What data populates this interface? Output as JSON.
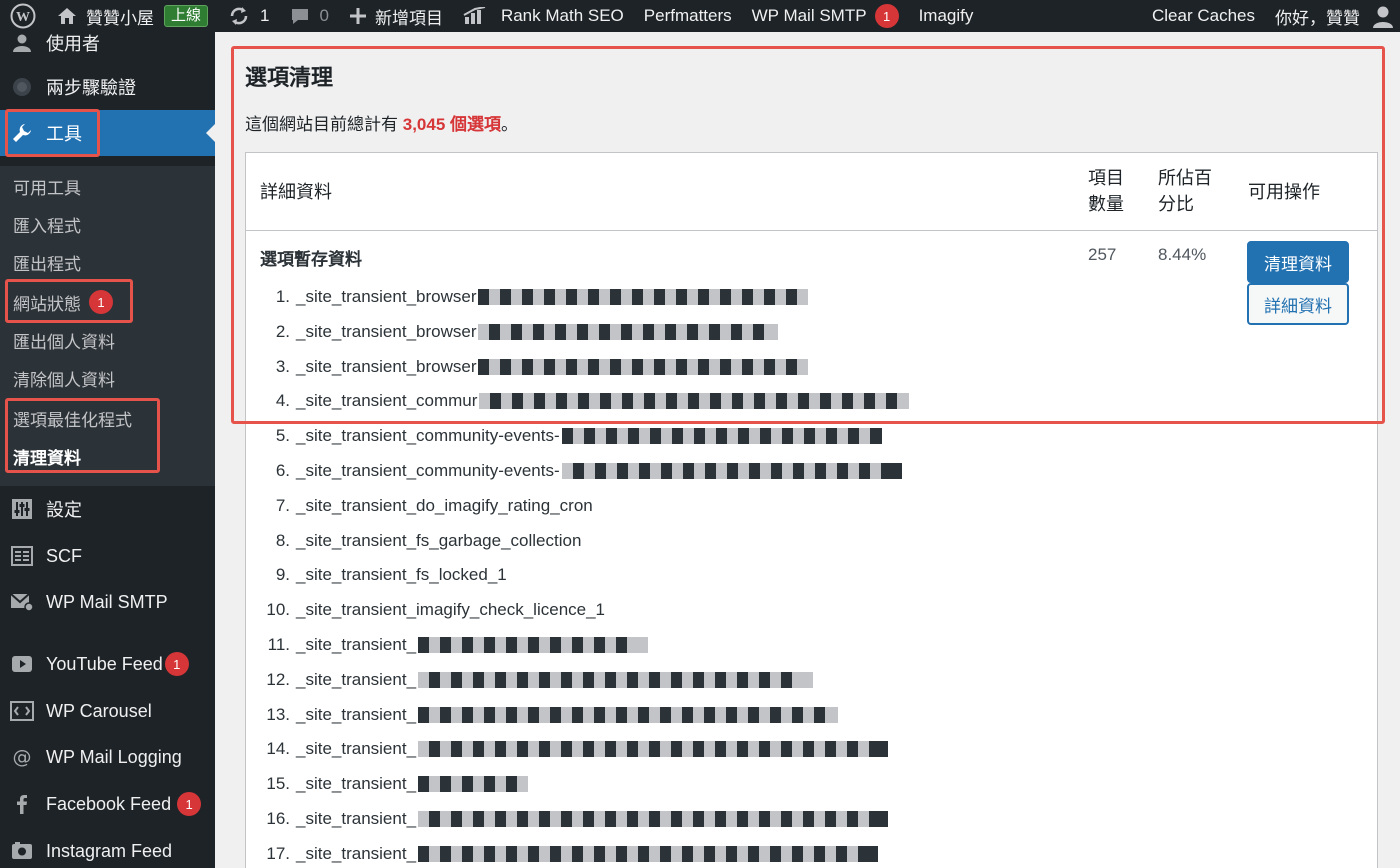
{
  "adminbar": {
    "site_name": "贊贊小屋",
    "live_label": "上線",
    "updates_count": "1",
    "comments_count": "0",
    "new_label": "新增項目",
    "rank_math": "Rank Math SEO",
    "perfmatters": "Perfmatters",
    "wp_mail_smtp": "WP Mail SMTP",
    "wp_mail_smtp_badge": "1",
    "imagify": "Imagify",
    "clear_caches": "Clear Caches",
    "greeting": "你好，贊贊"
  },
  "sidebar": {
    "users_partial": "使用者",
    "two_step": "兩步驟驗證",
    "tools": "工具",
    "submenu": [
      {
        "label": "可用工具"
      },
      {
        "label": "匯入程式"
      },
      {
        "label": "匯出程式"
      },
      {
        "label": "網站狀態",
        "badge": "1"
      },
      {
        "label": "匯出個人資料"
      },
      {
        "label": "清除個人資料"
      },
      {
        "label": "選項最佳化程式"
      },
      {
        "label": "清理資料"
      }
    ],
    "settings": "設定",
    "scf": "SCF",
    "wp_mail_smtp": "WP Mail SMTP",
    "youtube_feed": "YouTube Feed",
    "youtube_badge": "1",
    "wp_carousel": "WP Carousel",
    "wp_mail_logging": "WP Mail Logging",
    "facebook_feed": "Facebook Feed",
    "facebook_badge": "1",
    "instagram_feed": "Instagram Feed"
  },
  "main": {
    "title": "選項清理",
    "summary_prefix": "這個網站目前總計有 ",
    "summary_highlight": "3,045 個選項",
    "summary_suffix": "。",
    "table": {
      "col_details": "詳細資料",
      "col_count_1": "項目",
      "col_count_2": "數量",
      "col_percent_1": "所佔百",
      "col_percent_2": "分比",
      "col_actions": "可用操作",
      "group_title": "選項暫存資料",
      "count": "257",
      "percent": "8.44%",
      "btn_clean": "清理資料",
      "btn_details": "詳細資料",
      "items": [
        {
          "num": "1.",
          "text": "_site_transient_browser"
        },
        {
          "num": "2.",
          "text": "_site_transient_browser"
        },
        {
          "num": "3.",
          "text": "_site_transient_browser"
        },
        {
          "num": "4.",
          "text": "_site_transient_commur"
        },
        {
          "num": "5.",
          "text": "_site_transient_community-events-"
        },
        {
          "num": "6.",
          "text": "_site_transient_community-events-"
        },
        {
          "num": "7.",
          "text": "_site_transient_do_imagify_rating_cron"
        },
        {
          "num": "8.",
          "text": "_site_transient_fs_garbage_collection"
        },
        {
          "num": "9.",
          "text": "_site_transient_fs_locked_1"
        },
        {
          "num": "10.",
          "text": "_site_transient_imagify_check_licence_1"
        },
        {
          "num": "11.",
          "text": "_site_transient_"
        },
        {
          "num": "12.",
          "text": "_site_transient_"
        },
        {
          "num": "13.",
          "text": "_site_transient_"
        },
        {
          "num": "14.",
          "text": "_site_transient_"
        },
        {
          "num": "15.",
          "text": "_site_transient_"
        },
        {
          "num": "16.",
          "text": "_site_transient_"
        },
        {
          "num": "17.",
          "text": "_site_transient_"
        }
      ]
    }
  }
}
